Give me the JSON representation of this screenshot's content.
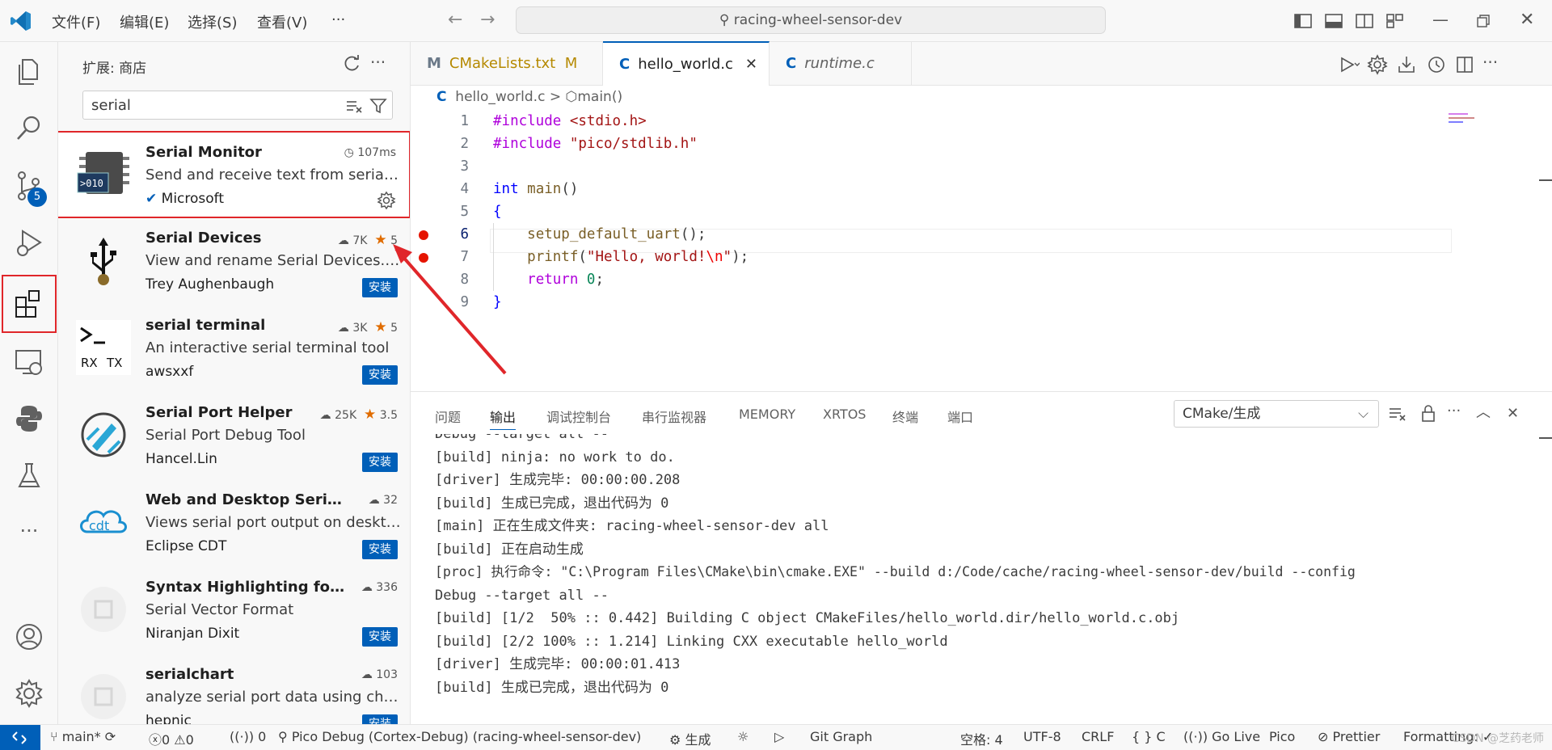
{
  "titlebar": {
    "menus": [
      "文件(F)",
      "编辑(E)",
      "选择(S)",
      "查看(V)",
      "···"
    ],
    "search": "racing-wheel-sensor-dev"
  },
  "activitybar": {
    "scm_badge": "5"
  },
  "sidebar": {
    "title": "扩展: 商店",
    "search_value": "serial",
    "extensions": [
      {
        "name": "Serial Monitor",
        "desc": "Send and receive text from serial ...",
        "publisher": "Microsoft",
        "meta": "107ms",
        "verified": true,
        "installed": true
      },
      {
        "name": "Serial Devices",
        "desc": "View and rename Serial Devices. V...",
        "publisher": "Trey Aughenbaugh",
        "downloads": "7K",
        "rating": "5",
        "install": "安装"
      },
      {
        "name": "serial terminal",
        "desc": "An interactive serial terminal tool",
        "publisher": "awsxxf",
        "downloads": "3K",
        "rating": "5",
        "install": "安装"
      },
      {
        "name": "Serial Port Helper",
        "desc": "Serial Port Debug Tool",
        "publisher": "Hancel.Lin",
        "downloads": "25K",
        "rating": "3.5",
        "install": "安装"
      },
      {
        "name": "Web and Desktop Serial ...",
        "desc": "Views serial port output on deskto...",
        "publisher": "Eclipse CDT",
        "downloads": "32",
        "install": "安装"
      },
      {
        "name": "Syntax Highlighting for ...",
        "desc": "Serial Vector Format",
        "publisher": "Niranjan Dixit",
        "downloads": "336",
        "install": "安装"
      },
      {
        "name": "serialchart",
        "desc": "analyze serial port data using charts",
        "publisher": "hepnic",
        "downloads": "103",
        "install": "安装"
      }
    ],
    "icon_labels": {
      "serial_monitor": ">010",
      "terminal_rx": "RX",
      "terminal_tx": "TX",
      "cdt": "cdt"
    }
  },
  "tabs": [
    {
      "label": "CMakeLists.txt",
      "icon": "M",
      "status": "M"
    },
    {
      "label": "hello_world.c",
      "icon": "C"
    },
    {
      "label": "runtime.c",
      "icon": "C"
    }
  ],
  "breadcrumb": {
    "icon": "C",
    "file": "hello_world.c",
    "sep": ">",
    "symbol": "main()"
  },
  "editor": {
    "line_numbers": [
      "1",
      "2",
      "3",
      "4",
      "5",
      "6",
      "7",
      "8",
      "9"
    ],
    "code": {
      "l1_kw": "#include",
      "l1_val": "<stdio.h>",
      "l2_kw": "#include",
      "l2_val": "\"pico/stdlib.h\"",
      "l4_type": "int",
      "l4_fn": "main",
      "l4_paren": "()",
      "l5": "{",
      "l6_fn": "setup_default_uart",
      "l6_rest": "();",
      "l7_fn": "printf",
      "l7_open": "(",
      "l7_str": "\"Hello, world!",
      "l7_esc": "\\n",
      "l7_strend": "\"",
      "l7_close": ");",
      "l8_kw": "return",
      "l8_num": "0",
      "l8_semi": ";",
      "l9": "}"
    }
  },
  "panel": {
    "tabs": [
      "问题",
      "输出",
      "调试控制台",
      "串行监视器",
      "MEMORY",
      "XRTOS",
      "终端",
      "端口"
    ],
    "active_tab": "输出",
    "select_value": "CMake/生成",
    "output": [
      "Debug --target all --",
      "[build] ninja: no work to do.",
      "[driver] 生成完毕: 00:00:00.208",
      "[build] 生成已完成，退出代码为 0",
      "[main] 正在生成文件夹: racing-wheel-sensor-dev all",
      "[build] 正在启动生成",
      "[proc] 执行命令: \"C:\\Program Files\\CMake\\bin\\cmake.EXE\" --build d:/Code/cache/racing-wheel-sensor-dev/build --config",
      "Debug --target all --",
      "[build] [1/2  50% :: 0.442] Building C object CMakeFiles/hello_world.dir/hello_world.c.obj",
      "[build] [2/2 100% :: 1.214] Linking CXX executable hello_world",
      "[driver] 生成完毕: 00:00:01.413",
      "[build] 生成已完成，退出代码为 0"
    ]
  },
  "statusbar": {
    "branch": "main*",
    "errors": "0",
    "warnings": "0",
    "ports": "0",
    "debug": "Pico Debug (Cortex-Debug) (racing-wheel-sensor-dev)",
    "build": "生成",
    "gitgraph": "Git Graph",
    "spaces": "空格: 4",
    "encoding": "UTF-8",
    "eol": "CRLF",
    "lang_braces": "{ }",
    "lang": "C",
    "golive": "Go Live",
    "pico": "Pico",
    "prettier": "Prettier",
    "formatting": "Formatting: ✓",
    "watermark": "CSDN @芝药老师"
  },
  "colors": {
    "accent": "#005fb8",
    "highlight_red": "#e0262a",
    "breakpoint": "#e51400"
  }
}
